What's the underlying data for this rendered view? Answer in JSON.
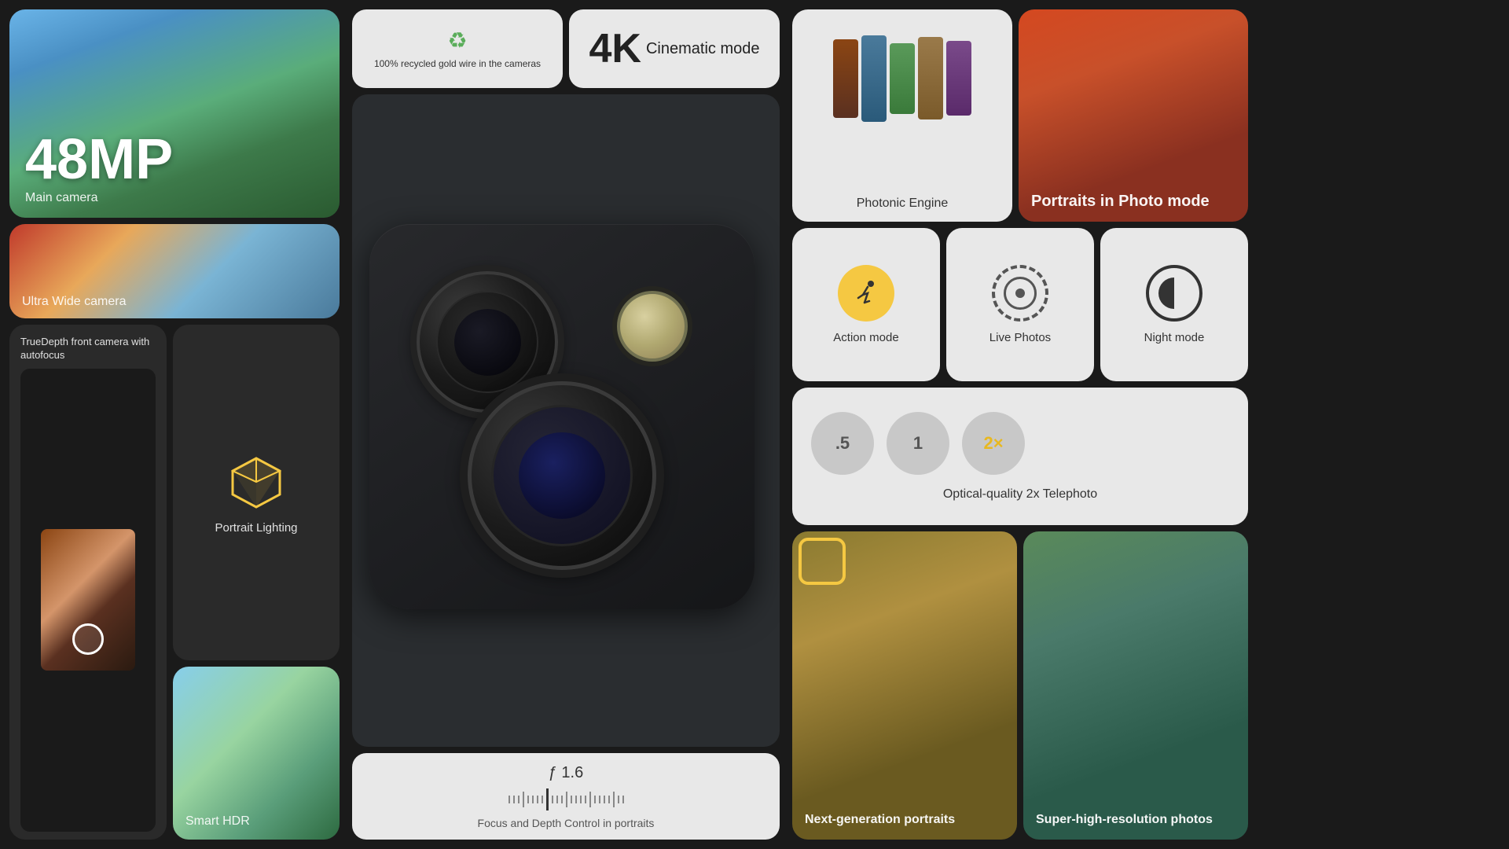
{
  "left": {
    "mp_label": "48MP",
    "main_camera_label": "Main camera",
    "ultrawide_label": "Ultra Wide camera",
    "truedepth_title": "TrueDepth front camera with autofocus",
    "portrait_lighting_label": "Portrait Lighting",
    "smart_hdr_label": "Smart HDR"
  },
  "middle": {
    "recycled_text": "100% recycled gold wire in the cameras",
    "fourk_label": "4K",
    "cinematic_label": "Cinematic mode",
    "aperture_label": "ƒ 1.6",
    "focus_label": "Focus and Depth Control in portraits"
  },
  "right": {
    "photonic_label": "Photonic Engine",
    "portraits_photo_label": "Portraits in Photo mode",
    "action_label": "Action mode",
    "live_photos_label": "Live Photos",
    "night_label": "Night mode",
    "telephoto_zoom_05": ".5",
    "telephoto_zoom_1": "1",
    "telephoto_zoom_2x": "2×",
    "telephoto_label": "Optical-quality 2x Telephoto",
    "next_gen_label": "Next-generation portraits",
    "super_high_label": "Super-high-resolution photos"
  }
}
